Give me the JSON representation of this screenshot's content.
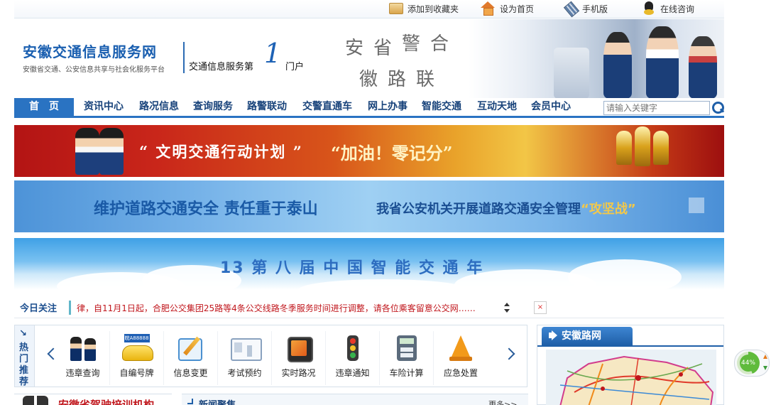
{
  "topbar": {
    "items": [
      {
        "label": "添加到收藏夹",
        "icon": "favorites-icon"
      },
      {
        "label": "设为首页",
        "icon": "home-icon"
      },
      {
        "label": "手机版",
        "icon": "mobile-icon"
      },
      {
        "label": "在线咨询",
        "icon": "qq-chat-icon"
      }
    ]
  },
  "header": {
    "site_title": "安徽交通信息服务网",
    "site_subtitle": "安徽省交通、公安信息共享与社会化服务平台",
    "slogan_before": "交通信息服务第",
    "slogan_number": "1",
    "slogan_after": "门户",
    "poem": [
      "安",
      "省",
      "警",
      "合",
      "徽",
      "路",
      "联"
    ]
  },
  "nav": {
    "items": [
      "首　页",
      "资讯中心",
      "路况信息",
      "查询服务",
      "路警联动",
      "交警直通车",
      "网上办事",
      "智能交通",
      "互动天地",
      "会员中心"
    ],
    "active_index": 0,
    "search_placeholder": "请输入关键字"
  },
  "banners": {
    "b1_text": "“ 文明交通行动计划 ”",
    "b1_text2": "“加油！零记分”",
    "b2_text": "维护道路交通安全  责任重于泰山",
    "b2_text2_before": "我省公安机关开展道路交通安全管理",
    "b2_text2_highlight": "“攻坚战”",
    "b3_text": "13 第 八 届 中 国 智 能 交 通 年"
  },
  "ticker": {
    "label": "今日关注",
    "text": "律，自11月1日起，合肥公交集团25路等4条公交线路冬季服务时间进行调整，请各位乘客留意公交网……"
  },
  "hot": {
    "label": [
      "热",
      "门",
      "推",
      "荐"
    ],
    "items": [
      {
        "label": "违章查询",
        "icon": "police-officers-icon"
      },
      {
        "label": "自编号牌",
        "icon": "license-plate-car-icon"
      },
      {
        "label": "信息变更",
        "icon": "edit-note-icon"
      },
      {
        "label": "考试预约",
        "icon": "id-card-icon"
      },
      {
        "label": "实时路况",
        "icon": "road-map-icon"
      },
      {
        "label": "违章通知",
        "icon": "traffic-light-icon"
      },
      {
        "label": "车险计算",
        "icon": "calculator-icon"
      },
      {
        "label": "应急处置",
        "icon": "traffic-cone-icon"
      }
    ]
  },
  "map_panel": {
    "title": "安徽路网"
  },
  "bottom": {
    "left_title": "安徽省驾驶培训机构",
    "mid_title": "新闻聚焦",
    "mid_more": "更多>>"
  },
  "float_widget": {
    "percent": "44%"
  },
  "colors": {
    "primary": "#2a73c2",
    "nav_text": "#17427a",
    "ticker_text": "#c0161c"
  }
}
